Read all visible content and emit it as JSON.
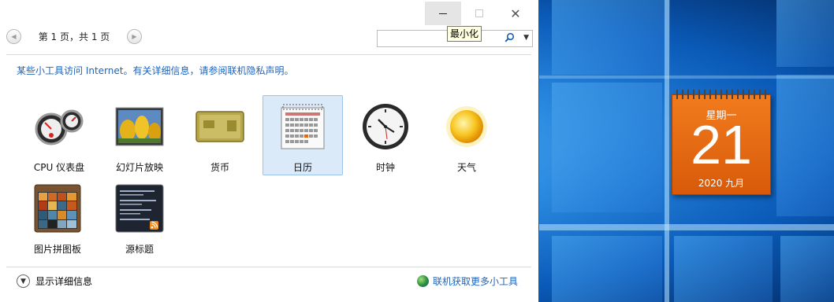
{
  "window": {
    "controls": {
      "minimize": "—",
      "maximize": "",
      "close": "✕"
    },
    "tooltip": "最小化"
  },
  "pager": {
    "prev": "◀",
    "text": "第 1 页，共 1 页",
    "next": "▶"
  },
  "search": {
    "value": "",
    "placeholder": "",
    "icon": "search-icon",
    "dropdown": "▼"
  },
  "info_text": "某些小工具访问 Internet。有关详细信息，请参阅联机隐私声明。",
  "gadgets": [
    {
      "label": "CPU 仪表盘",
      "icon": "cpu-meter-icon",
      "selected": false
    },
    {
      "label": "幻灯片放映",
      "icon": "slideshow-icon",
      "selected": false
    },
    {
      "label": "货币",
      "icon": "currency-icon",
      "selected": false
    },
    {
      "label": "日历",
      "icon": "calendar-icon",
      "selected": true
    },
    {
      "label": "时钟",
      "icon": "clock-icon",
      "selected": false
    },
    {
      "label": "天气",
      "icon": "weather-icon",
      "selected": false
    },
    {
      "label": "图片拼图板",
      "icon": "picture-puzzle-icon",
      "selected": false
    },
    {
      "label": "源标题",
      "icon": "feed-headlines-icon",
      "selected": false
    }
  ],
  "footer": {
    "details_label": "显示详细信息",
    "online_label": "联机获取更多小工具"
  },
  "desktop_calendar": {
    "weekday": "星期一",
    "day": "21",
    "month": "2020 九月"
  },
  "colors": {
    "accent": "#1e64b8",
    "selection": "#dbeaf9",
    "calendar_orange": "#e8660f"
  }
}
